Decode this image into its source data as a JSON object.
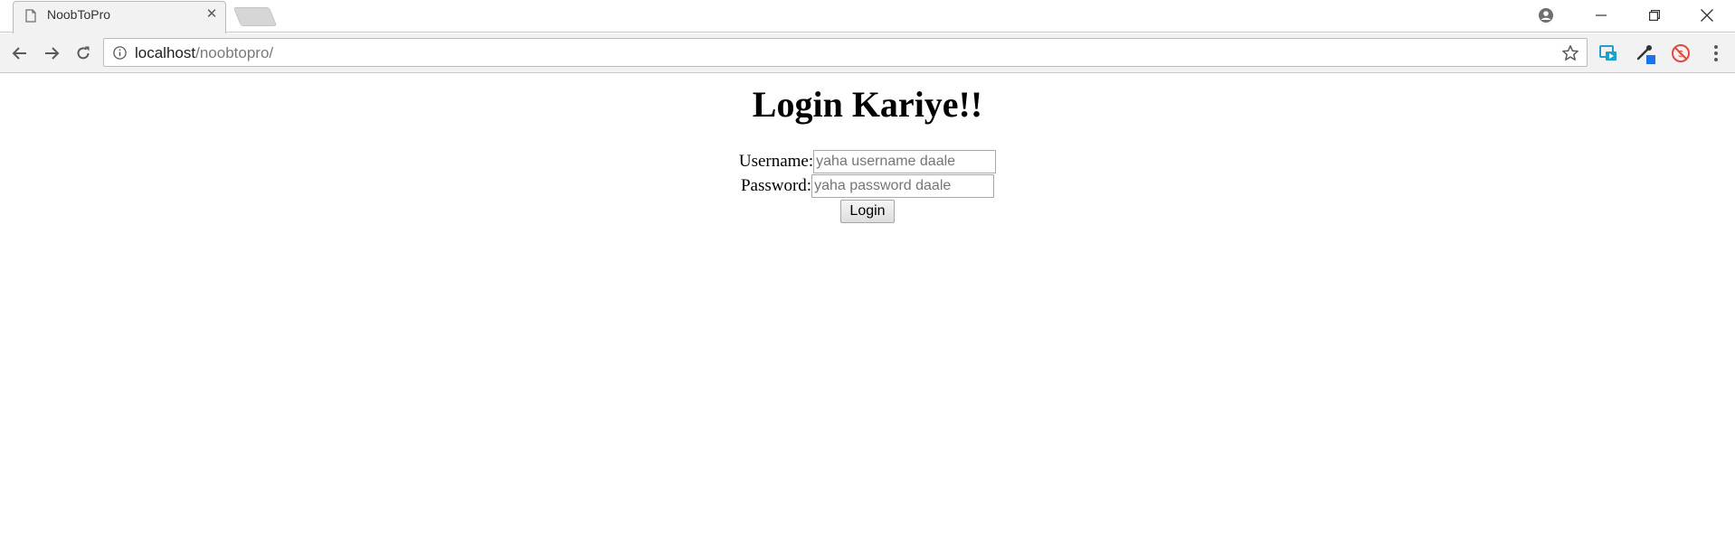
{
  "browser": {
    "tab": {
      "title": "NoobToPro",
      "favicon": "document-icon",
      "close_icon": "close-icon"
    },
    "new_tab_icon": "new-tab-icon",
    "window_controls": [
      "profile-icon",
      "minimize-icon",
      "restore-icon",
      "close-icon"
    ],
    "toolbar": {
      "back_icon": "arrow-left-icon",
      "forward_icon": "arrow-right-icon",
      "reload_icon": "reload-icon",
      "url_host": "localhost",
      "url_path": "/noobtopro/",
      "info_icon": "info-icon",
      "bookmark_icon": "star-icon",
      "extensions": [
        "screencast-icon",
        "eyedropper-icon",
        "block-icon"
      ],
      "menu_icon": "more-vert-icon"
    }
  },
  "page": {
    "heading": "Login Kariye!!",
    "username": {
      "label": "Username:",
      "value": "",
      "placeholder": "yaha username daale"
    },
    "password": {
      "label": "Password:",
      "value": "",
      "placeholder": "yaha password daale"
    },
    "submit_label": "Login"
  },
  "colors": {
    "accent_blue": "#1a73e8",
    "extension_teal": "#1da1c9",
    "block_red": "#e04b3f"
  }
}
